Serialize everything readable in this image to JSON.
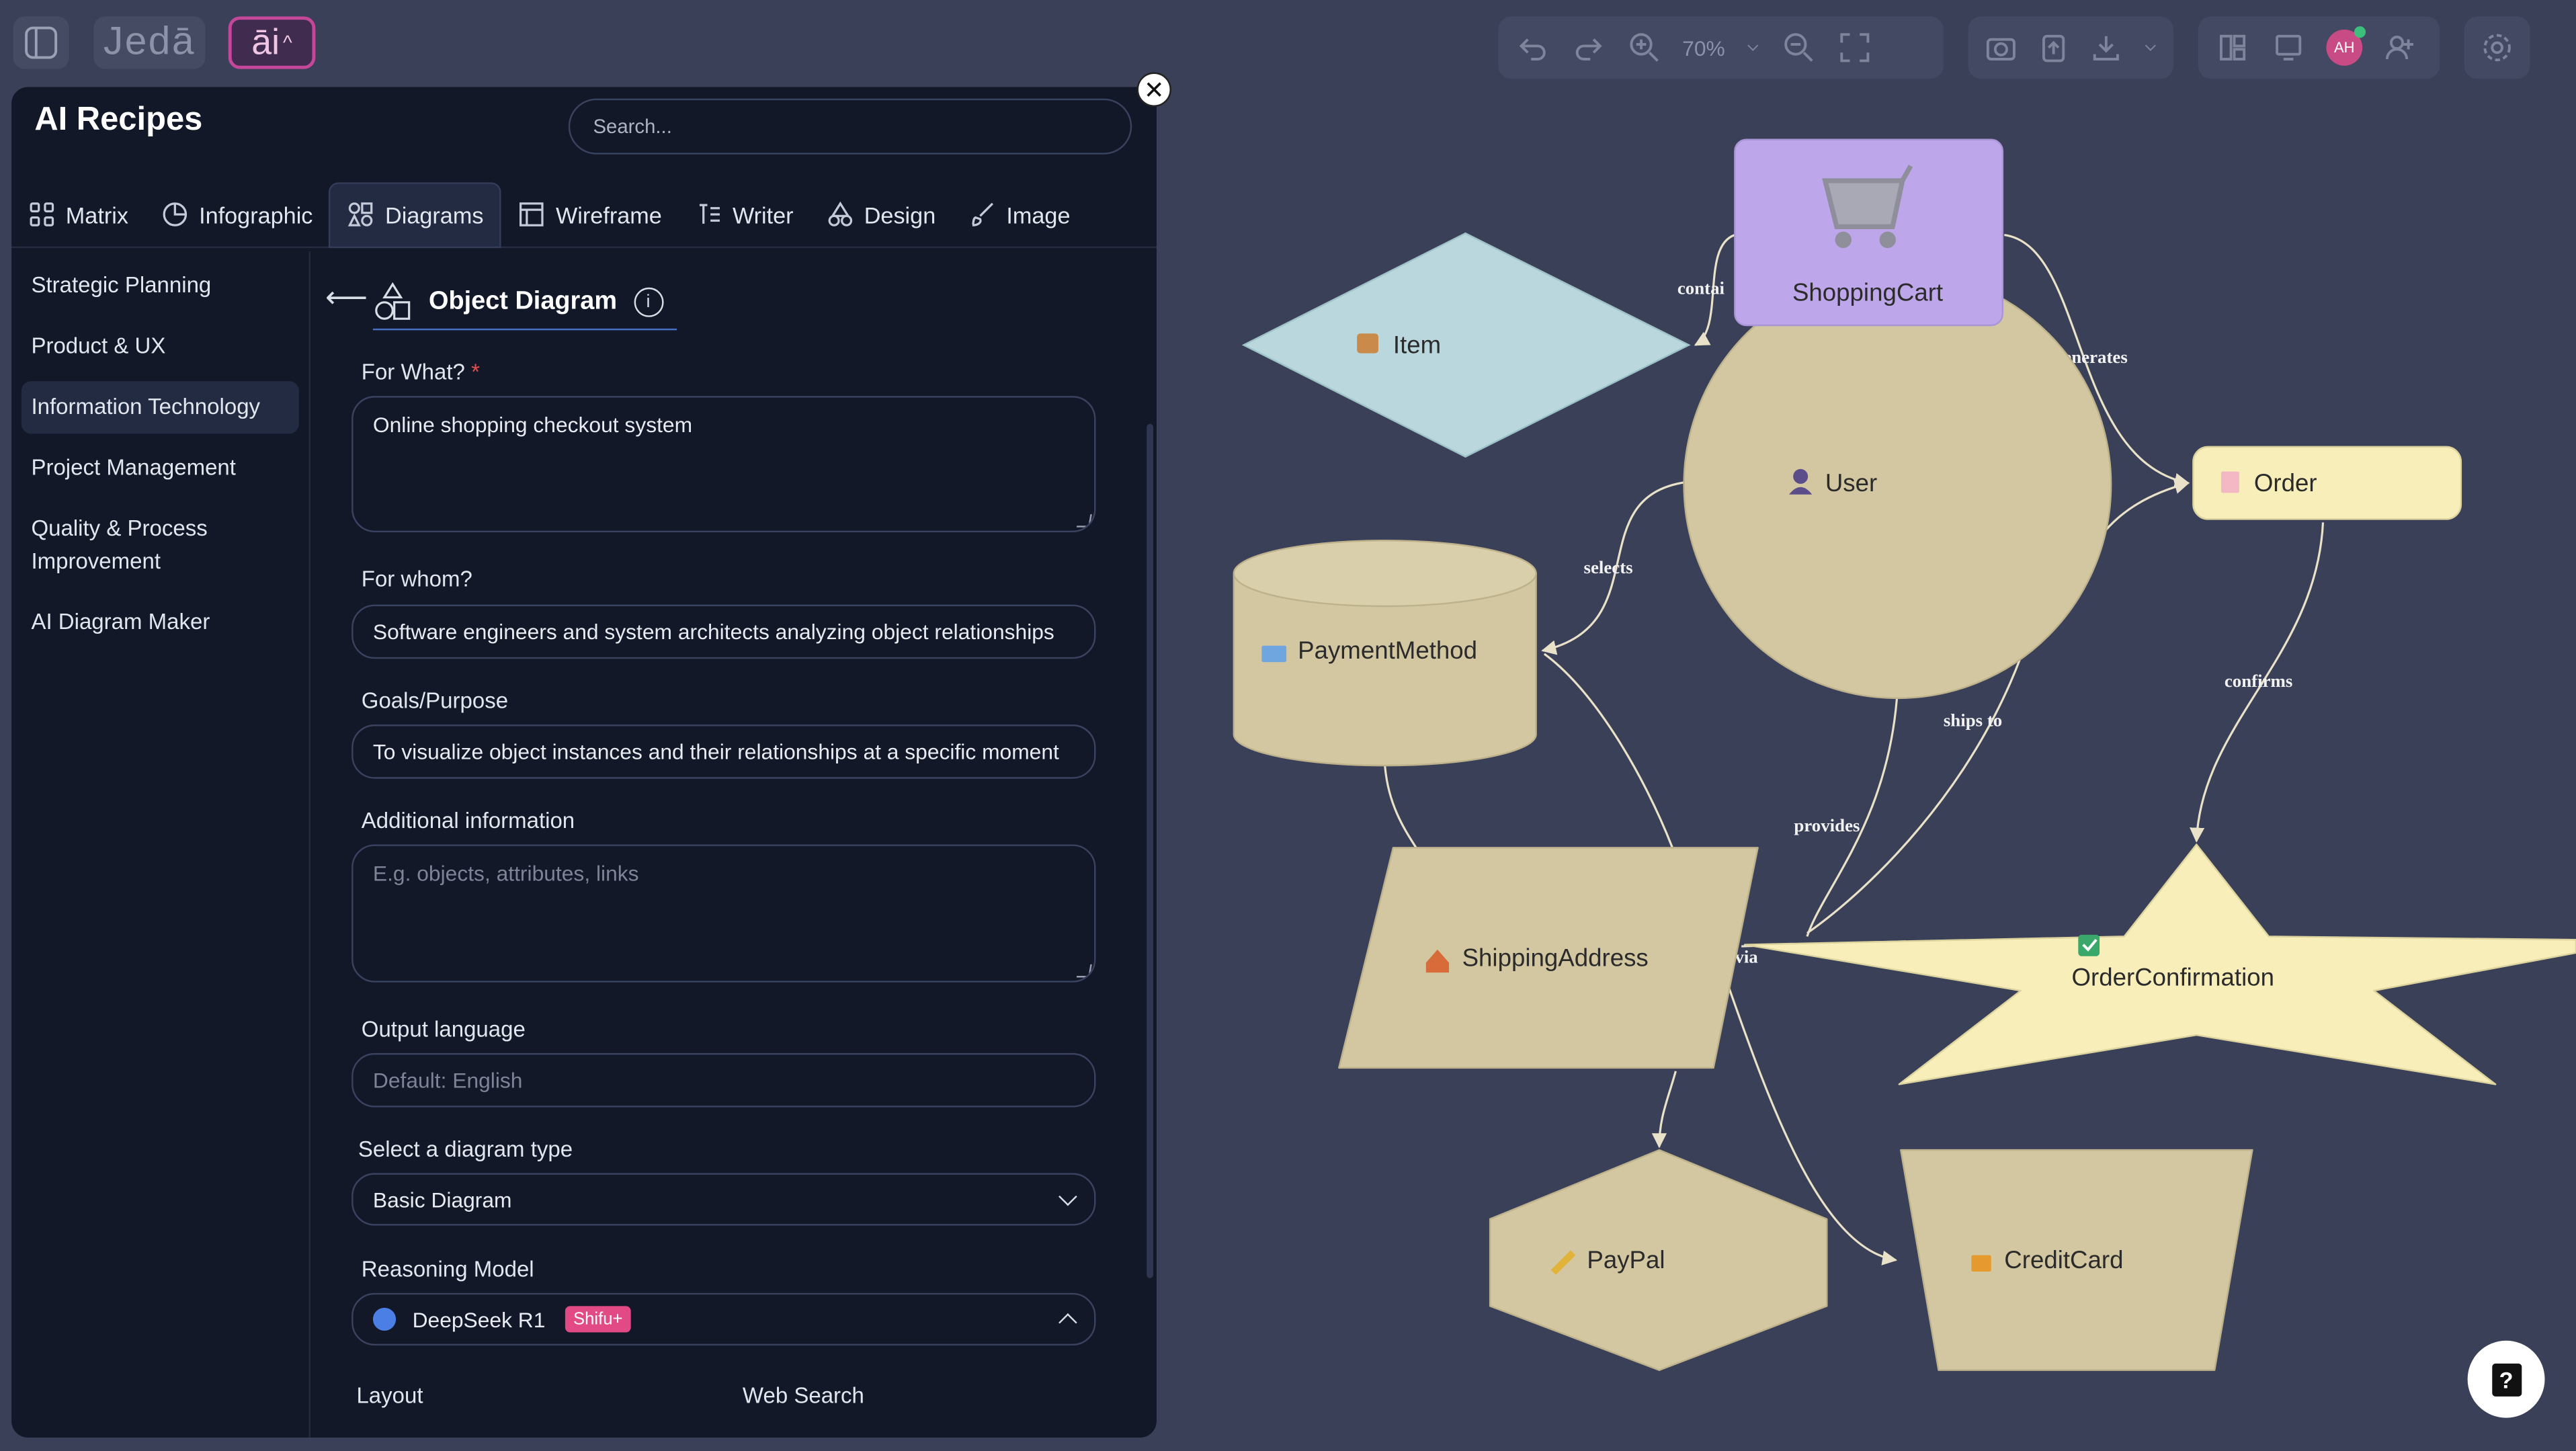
{
  "app": {
    "logo": "Jedā",
    "ai_button": "āi"
  },
  "toolbar": {
    "zoom": "70%",
    "avatar_initials": "AH"
  },
  "panel": {
    "title": "AI Recipes",
    "search_placeholder": "Search...",
    "tabs": [
      {
        "label": "Matrix",
        "icon": "grid-icon"
      },
      {
        "label": "Infographic",
        "icon": "pie-icon"
      },
      {
        "label": "Diagrams",
        "icon": "shapes-icon",
        "active": true
      },
      {
        "label": "Wireframe",
        "icon": "wireframe-icon"
      },
      {
        "label": "Writer",
        "icon": "text-icon"
      },
      {
        "label": "Design",
        "icon": "design-icon"
      },
      {
        "label": "Image",
        "icon": "brush-icon"
      }
    ],
    "categories": [
      {
        "label": "Strategic Planning"
      },
      {
        "label": "Product & UX"
      },
      {
        "label": "Information Technology",
        "active": true
      },
      {
        "label": "Project Management"
      },
      {
        "label": "Quality & Process Improvement"
      },
      {
        "label": "AI Diagram Maker"
      }
    ],
    "form": {
      "heading": "Object Diagram",
      "for_what_label": "For What?",
      "for_what_value": "Online shopping checkout system",
      "for_whom_label": "For whom?",
      "for_whom_value": "Software engineers and system architects analyzing object relationships",
      "goals_label": "Goals/Purpose",
      "goals_value": "To visualize object instances and their relationships at a specific moment",
      "additional_label": "Additional information",
      "additional_placeholder": "E.g. objects, attributes, links",
      "language_label": "Output language",
      "language_placeholder": "Default: English",
      "diagram_type_label": "Select a diagram type",
      "diagram_type_value": "Basic Diagram",
      "model_label": "Reasoning Model",
      "model_value": "DeepSeek R1",
      "model_badge": "Shifu+",
      "layout_label": "Layout",
      "websearch_label": "Web Search"
    }
  },
  "diagram": {
    "nodes": {
      "item": "Item",
      "shoppingcart": "ShoppingCart",
      "user": "User",
      "order": "Order",
      "paymentmethod": "PaymentMethod",
      "shippingaddress": "ShippingAddress",
      "orderconfirmation": "OrderConfirmation",
      "paypal": "PayPal",
      "creditcard": "CreditCard"
    },
    "edges": {
      "contains": "contai",
      "generates": "enerates",
      "selects": "selects",
      "ships_to": "ships to",
      "confirms": "confirms",
      "provides": "provides",
      "via": "via"
    },
    "colors": {
      "diamond": "#b9d7dc",
      "cart": "#bda6ea",
      "tan": "#d2c7a0",
      "cream": "#f7eeba",
      "canvas": "#3a4058"
    }
  }
}
